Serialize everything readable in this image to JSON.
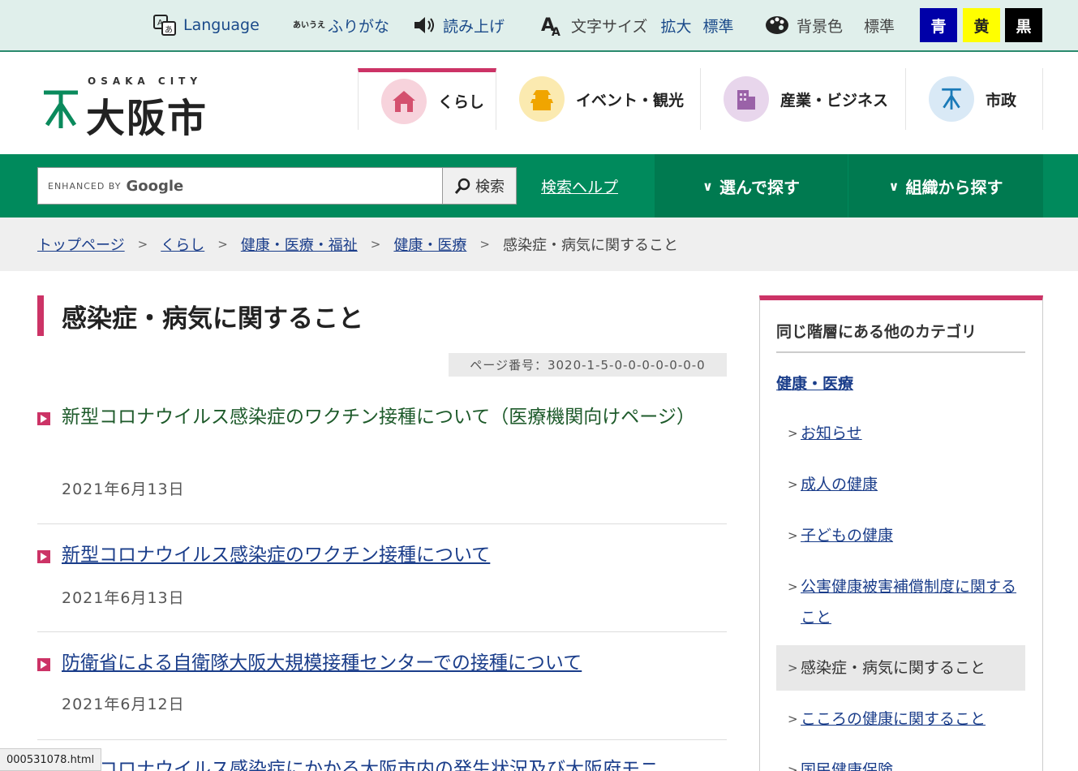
{
  "util": {
    "language": "Language",
    "furigana": "ふりがな",
    "furigana_icon_text": "あいうえ",
    "read_aloud": "読み上げ",
    "font_size_label": "文字サイズ",
    "font_enlarge": "拡大",
    "font_standard": "標準",
    "bg_label": "背景色",
    "bg_standard": "標準",
    "bg_blue": "青",
    "bg_yellow": "黄",
    "bg_black": "黒"
  },
  "logo": {
    "sub": "OSAKA CITY",
    "main": "大阪市"
  },
  "nav": [
    {
      "label": "くらし"
    },
    {
      "label": "イベント・観光"
    },
    {
      "label": "産業・ビジネス"
    },
    {
      "label": "市政"
    }
  ],
  "search": {
    "enhanced": "ENHANCED BY",
    "google": "Google",
    "button": "検索",
    "help": "検索ヘルプ"
  },
  "green_nav": {
    "browse": "選んで探す",
    "org": "組織から探す"
  },
  "breadcrumb": {
    "items": [
      "トップページ",
      "くらし",
      "健康・医療・福祉",
      "健康・医療"
    ],
    "current": "感染症・病気に関すること"
  },
  "main": {
    "title": "感染症・病気に関すること",
    "page_number": "ページ番号：3020-1-5-0-0-0-0-0-0-0"
  },
  "articles": [
    {
      "title": "新型コロナウイルス感染症のワクチン接種について（医療機関向けページ）",
      "date": "2021年6月13日"
    },
    {
      "title": "新型コロナウイルス感染症のワクチン接種について",
      "date": "2021年6月13日"
    },
    {
      "title": "防衛省による自衛隊大阪大規模接種センターでの接種について",
      "date": "2021年6月12日"
    },
    {
      "title": "新型コロナウイルス感染症にかかる大阪市内の発生状況及び大阪府モニ"
    }
  ],
  "sidebar": {
    "heading": "同じ階層にある他のカテゴリ",
    "parent": "健康・医療",
    "items": [
      "お知らせ",
      "成人の健康",
      "子どもの健康",
      "公害健康被害補償制度に関すること",
      "感染症・病気に関すること",
      "こころの健康に関すること",
      "国民健康保険"
    ]
  },
  "status_bar": {
    "url": "000531078.html"
  },
  "colors": {
    "accent_pink": "#cc3366",
    "brand_green": "#008a5c",
    "bg_blue": "#0000a8",
    "bg_yellow": "#ffff00",
    "bg_black": "#000000"
  }
}
